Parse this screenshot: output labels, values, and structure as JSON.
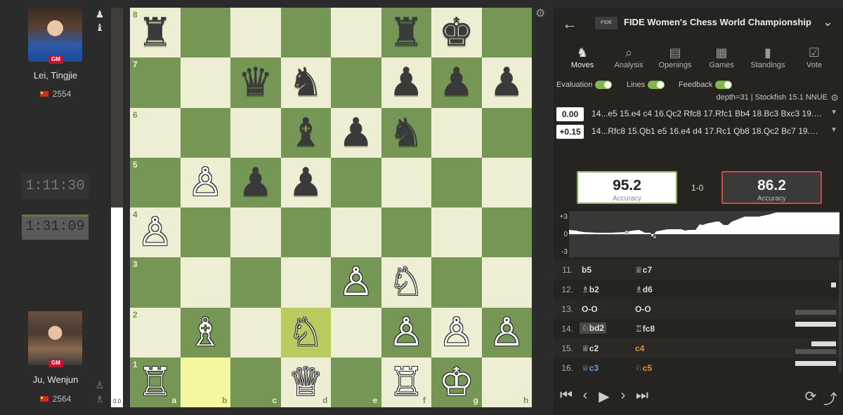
{
  "players": {
    "top": {
      "name": "Lei, Tingjie",
      "rating": "2554",
      "title": "GM",
      "clock": "1:11:30"
    },
    "bottom": {
      "name": "Ju, Wenjun",
      "rating": "2564",
      "title": "GM",
      "clock": "1:31:09"
    }
  },
  "eval_bar": {
    "value": "0.0",
    "white_fraction": 0.5
  },
  "board": {
    "ranks": [
      "8",
      "7",
      "6",
      "5",
      "4",
      "3",
      "2",
      "1"
    ],
    "files": [
      "a",
      "b",
      "c",
      "d",
      "e",
      "f",
      "g",
      "h"
    ],
    "highlight_squares": [
      "b1",
      "d2"
    ],
    "pieces": [
      {
        "sq": "a8",
        "glyph": "♜",
        "side": "b",
        "name": "black-rook-a8"
      },
      {
        "sq": "f8",
        "glyph": "♜",
        "side": "b",
        "name": "black-rook-f8"
      },
      {
        "sq": "g8",
        "glyph": "♚",
        "side": "b",
        "name": "black-king-g8"
      },
      {
        "sq": "c7",
        "glyph": "♛",
        "side": "b",
        "name": "black-queen-c7"
      },
      {
        "sq": "d7",
        "glyph": "♞",
        "side": "b",
        "name": "black-knight-d7"
      },
      {
        "sq": "f7",
        "glyph": "♟",
        "side": "b",
        "name": "black-pawn-f7"
      },
      {
        "sq": "g7",
        "glyph": "♟",
        "side": "b",
        "name": "black-pawn-g7"
      },
      {
        "sq": "h7",
        "glyph": "♟",
        "side": "b",
        "name": "black-pawn-h7"
      },
      {
        "sq": "d6",
        "glyph": "♝",
        "side": "b",
        "name": "black-bishop-d6"
      },
      {
        "sq": "e6",
        "glyph": "♟",
        "side": "b",
        "name": "black-pawn-e6"
      },
      {
        "sq": "f6",
        "glyph": "♞",
        "side": "b",
        "name": "black-knight-f6"
      },
      {
        "sq": "c5",
        "glyph": "♟",
        "side": "b",
        "name": "black-pawn-c5"
      },
      {
        "sq": "d5",
        "glyph": "♟",
        "side": "b",
        "name": "black-pawn-d5"
      },
      {
        "sq": "b5",
        "glyph": "♙",
        "side": "w",
        "name": "white-pawn-b5"
      },
      {
        "sq": "a4",
        "glyph": "♙",
        "side": "w",
        "name": "white-pawn-a4"
      },
      {
        "sq": "e3",
        "glyph": "♙",
        "side": "w",
        "name": "white-pawn-e3"
      },
      {
        "sq": "f3",
        "glyph": "♘",
        "side": "w",
        "name": "white-knight-f3"
      },
      {
        "sq": "b2",
        "glyph": "♗",
        "side": "w",
        "name": "white-bishop-b2"
      },
      {
        "sq": "d2",
        "glyph": "♘",
        "side": "w",
        "name": "white-knight-d2"
      },
      {
        "sq": "f2",
        "glyph": "♙",
        "side": "w",
        "name": "white-pawn-f2"
      },
      {
        "sq": "g2",
        "glyph": "♙",
        "side": "w",
        "name": "white-pawn-g2"
      },
      {
        "sq": "h2",
        "glyph": "♙",
        "side": "w",
        "name": "white-pawn-h2"
      },
      {
        "sq": "a1",
        "glyph": "♖",
        "side": "w",
        "name": "white-rook-a1"
      },
      {
        "sq": "d1",
        "glyph": "♕",
        "side": "w",
        "name": "white-queen-d1"
      },
      {
        "sq": "f1",
        "glyph": "♖",
        "side": "w",
        "name": "white-rook-f1"
      },
      {
        "sq": "g1",
        "glyph": "♔",
        "side": "w",
        "name": "white-king-g1"
      }
    ]
  },
  "panel": {
    "event_title": "FIDE Women's Chess World Championship",
    "tabs": [
      {
        "label": "Moves",
        "icon": "moves-icon",
        "glyph": "♞",
        "active": true
      },
      {
        "label": "Analysis",
        "icon": "analysis-icon",
        "glyph": "⌕",
        "active": false
      },
      {
        "label": "Openings",
        "icon": "openings-icon",
        "glyph": "▤",
        "active": false
      },
      {
        "label": "Games",
        "icon": "games-icon",
        "glyph": "▦",
        "active": false
      },
      {
        "label": "Standings",
        "icon": "standings-icon",
        "glyph": "▮",
        "active": false
      },
      {
        "label": "Vote",
        "icon": "vote-icon",
        "glyph": "☑",
        "active": false
      }
    ],
    "toggles": {
      "evaluation": "Evaluation",
      "lines": "Lines",
      "feedback": "Feedback"
    },
    "engine_info": "depth=31 | Stockfish 15.1 NNUE",
    "lines": [
      {
        "score": "0.00",
        "moves": "14...e5 15.e4 c4 16.Qc2 Rfc8 17.Rfc1 Bb4 18.Bc3 Bxc3 19.Qx..."
      },
      {
        "score": "+0.15",
        "moves": "14...Rfc8 15.Qb1 e5 16.e4 d4 17.Rc1 Qb8 18.Qc2 Bc7 19.Nc..."
      }
    ],
    "accuracy": {
      "white": "95.2",
      "black": "86.2",
      "label": "Accuracy",
      "result": "1-0"
    },
    "graph": {
      "top": "+3",
      "mid": "0",
      "bottom": "-3"
    },
    "moves": [
      {
        "num": "11.",
        "white": "b5",
        "black": "c7",
        "black_icon": "♕"
      },
      {
        "num": "12.",
        "white": "b2",
        "white_icon": "♗",
        "black": "d6",
        "black_icon": "♗"
      },
      {
        "num": "13.",
        "white": "O-O",
        "black": "O-O"
      },
      {
        "num": "14.",
        "white": "bd2",
        "white_icon": "♘",
        "black": "fc8",
        "black_icon": "♖"
      },
      {
        "num": "15.",
        "white": "c2",
        "white_icon": "♕",
        "black": "c4"
      },
      {
        "num": "16.",
        "white": "c3",
        "white_icon": "♕",
        "black": "c5",
        "black_icon": "♘"
      }
    ]
  }
}
